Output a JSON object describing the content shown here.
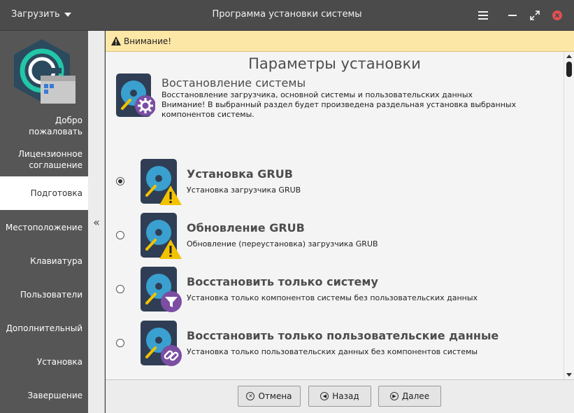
{
  "titlebar": {
    "load_label": "Загрузить",
    "title": "Программа установки системы"
  },
  "sidebar": {
    "items": [
      {
        "label": "Добро пожаловать"
      },
      {
        "label": "Лицензионное соглашение"
      },
      {
        "label": "Подготовка",
        "active": true
      },
      {
        "label": "Местоположение"
      },
      {
        "label": "Клавиатура"
      },
      {
        "label": "Пользователи"
      },
      {
        "label": "Дополнительный"
      },
      {
        "label": "Установка"
      },
      {
        "label": "Завершение"
      }
    ],
    "collapse_glyph": "«"
  },
  "warning": {
    "text": "Внимание!"
  },
  "content": {
    "page_title": "Параметры установки",
    "header": {
      "title": "Востановление системы",
      "line1": "Восстановление загрузчика, основной системы и пользовательских данных",
      "line2": "Внимание! В выбранный раздел будет произведена раздельная установка выбранных компонентов системы."
    },
    "options": [
      {
        "title": "Установка GRUB",
        "desc": "Установка загрузчика GRUB",
        "badge": "warning-icon",
        "selected": true
      },
      {
        "title": "Обновление GRUB",
        "desc": "Обновление (переустановка) загрузчика GRUB",
        "badge": "warning-icon",
        "selected": false
      },
      {
        "title": "Восстановить только систему",
        "desc": "Установка только компонентов системы без пользовательских данных",
        "badge": "filter-icon",
        "selected": false
      },
      {
        "title": "Восстановить только пользовательские данные",
        "desc": "Установка только пользовательских данных без компонентов системы",
        "badge": "link-icon",
        "selected": false
      }
    ]
  },
  "footer": {
    "cancel": "Отмена",
    "back": "Назад",
    "next": "Далее"
  },
  "colors": {
    "accent_blue": "#3aa0cf",
    "disk_dark": "#2f3e55",
    "badge_purple": "#7b4ea3",
    "warning_yellow": "#f2c200",
    "sidebar": "#565656",
    "warning_bar": "#fde7a6"
  }
}
